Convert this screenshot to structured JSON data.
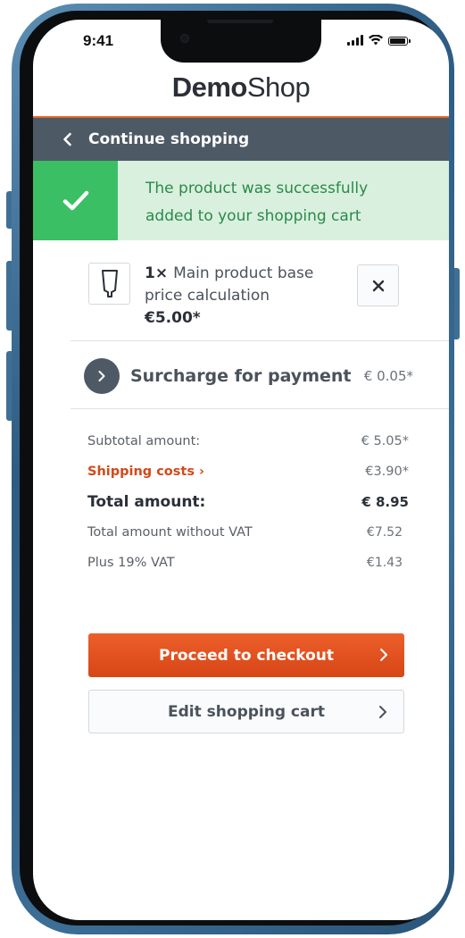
{
  "status_bar": {
    "time": "9:41"
  },
  "logo": {
    "bold": "Demo",
    "light": "Shop"
  },
  "nav": {
    "back_label": "Continue shopping",
    "icon": "chevron-left-icon"
  },
  "alert": {
    "message": "The product was successfully added to your shopping cart",
    "icon": "checkmark-icon",
    "color": "#3bbf65"
  },
  "product": {
    "quantity": "1×",
    "name": "Main product base price calculation",
    "price": "€5.00*",
    "remove_icon": "close-icon"
  },
  "surcharge": {
    "label": "Surcharge for payment",
    "value": "€ 0.05*"
  },
  "summary": {
    "subtotal_label": "Subtotal amount:",
    "subtotal_value": "€ 5.05*",
    "shipping_label": "Shipping costs",
    "shipping_value": "€3.90*",
    "total_label": "Total amount:",
    "total_value": "€ 8.95",
    "net_label": "Total amount without VAT",
    "net_value": "€7.52",
    "vat_label": "Plus 19% VAT",
    "vat_value": "€1.43"
  },
  "buttons": {
    "checkout_label": "Proceed to checkout",
    "edit_label": "Edit shopping cart"
  },
  "colors": {
    "accent": "#e3672b",
    "header": "#4e5966",
    "success_bg": "#daf0df",
    "shipping_text": "#d24a1a"
  }
}
